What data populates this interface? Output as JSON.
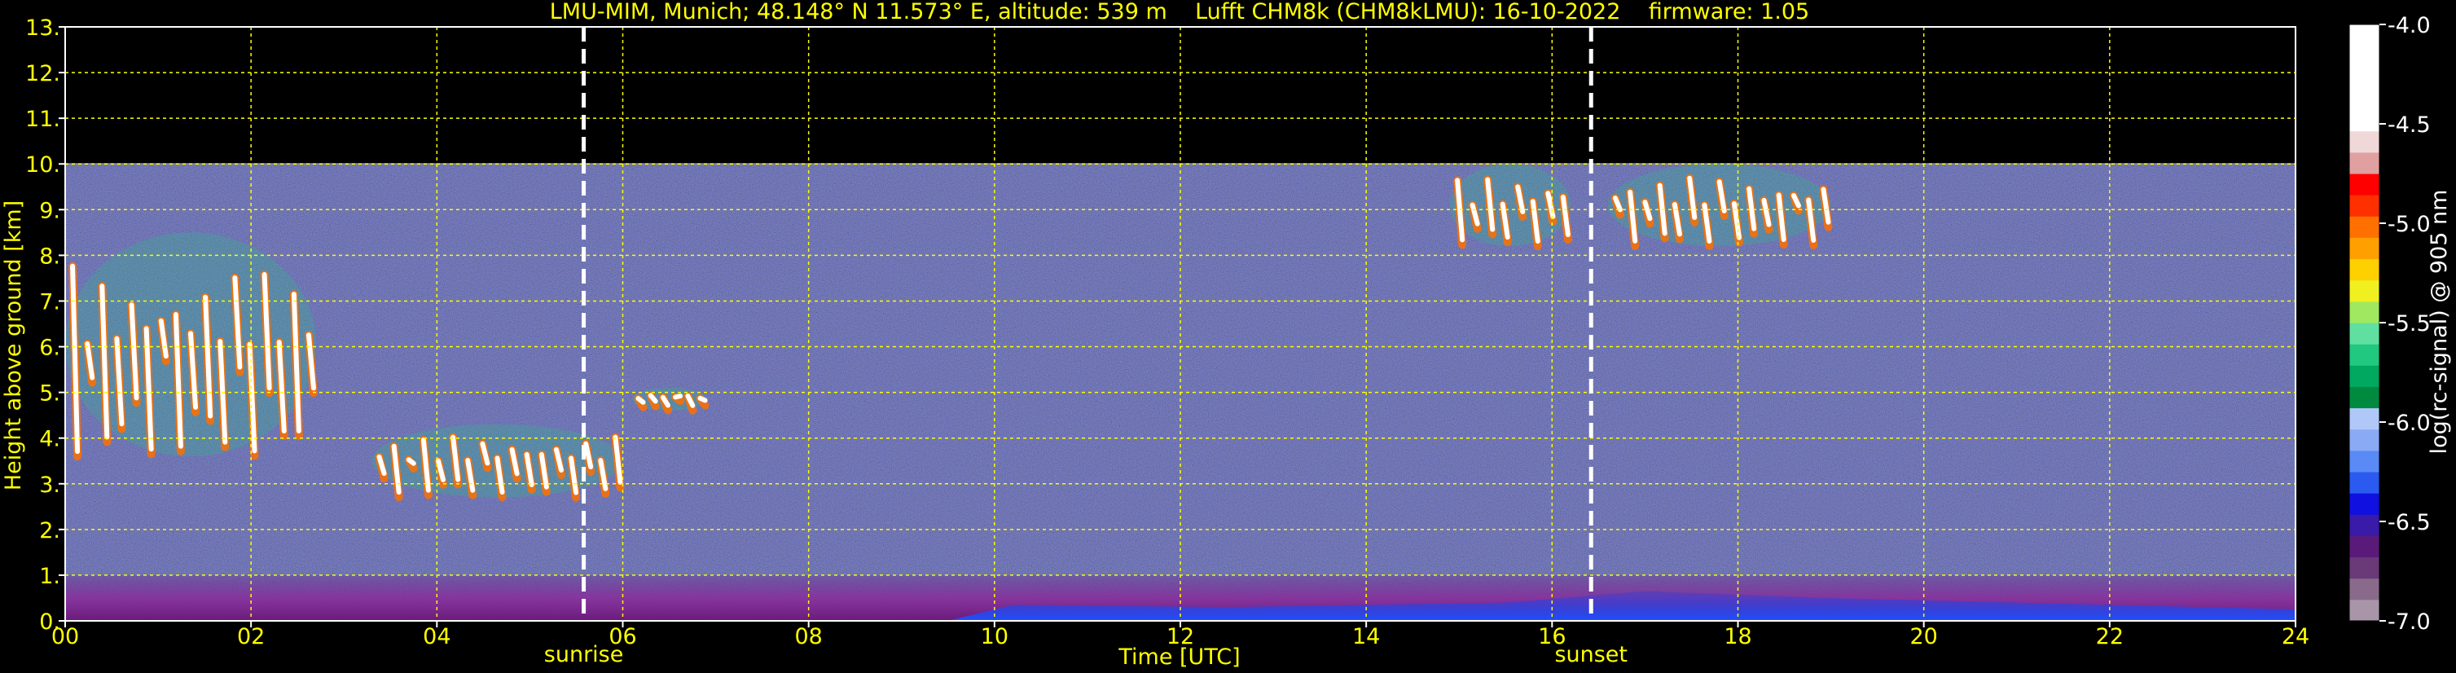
{
  "chart_data": {
    "type": "heatmap",
    "title": "LMU-MIM, Munich; 48.148° N 11.573° E, altitude: 539 m    Lufft CHM8k (CHM8kLMU): 16-10-2022    firmware: 1.05",
    "xlabel": "Time [UTC]",
    "ylabel": "Height above ground [km]",
    "xlim": [
      0,
      24
    ],
    "ylim": [
      0,
      13
    ],
    "x_ticks": [
      "00",
      "02",
      "04",
      "06",
      "08",
      "10",
      "12",
      "14",
      "16",
      "18",
      "20",
      "22",
      "24"
    ],
    "y_ticks": [
      "0.",
      "1.",
      "2.",
      "3.",
      "4.",
      "5.",
      "6.",
      "7.",
      "8.",
      "9.",
      "10.",
      "11.",
      "12.",
      "13."
    ],
    "grid": true,
    "data_top_km": 10,
    "events": [
      {
        "label": "sunrise",
        "time": 5.58
      },
      {
        "label": "sunset",
        "time": 16.42
      }
    ],
    "colorbar": {
      "label": "log(rc-signal) @ 905 nm",
      "range": [
        -7.0,
        -4.0
      ],
      "ticks": [
        "-4.0",
        "-4.5",
        "-5.0",
        "-5.5",
        "-6.0",
        "-6.5",
        "-7.0"
      ],
      "tick_values": [
        -4.0,
        -4.5,
        -5.0,
        -5.5,
        -6.0,
        -6.5,
        -7.0
      ],
      "colors": [
        "#a895a8",
        "#8a6a8a",
        "#6a3a78",
        "#5a1a7a",
        "#3a1aa8",
        "#1010e0",
        "#2a5af0",
        "#5a8af5",
        "#8aaaf5",
        "#b0c8f8",
        "#008a40",
        "#00a860",
        "#20c880",
        "#60e0a0",
        "#a0e860",
        "#f0f020",
        "#ffd000",
        "#ffa000",
        "#ff7000",
        "#ff3000",
        "#ff0000",
        "#e0a0a0",
        "#f0d8d8",
        "#ffffff",
        "#ffffff",
        "#ffffff",
        "#ffffff",
        "#ffffff"
      ]
    },
    "features": {
      "boundary_layer": {
        "from": 0,
        "to": 24,
        "top_km": 1.0
      },
      "clouds": [
        {
          "t0": 0.0,
          "t1": 2.7,
          "h_top": 8.5,
          "h_bottom": 3.6
        },
        {
          "t0": 3.3,
          "t1": 6.0,
          "h_top": 4.3,
          "h_bottom": 2.7
        },
        {
          "t0": 6.1,
          "t1": 6.9,
          "h_top": 5.1,
          "h_bottom": 4.6
        },
        {
          "t0": 14.9,
          "t1": 16.2,
          "h_top": 10.0,
          "h_bottom": 8.2
        },
        {
          "t0": 16.6,
          "t1": 19.0,
          "h_top": 10.0,
          "h_bottom": 8.2
        }
      ]
    },
    "colors": {
      "text": "#ffff00",
      "grid": "#ffff00",
      "background": "#000000",
      "noise_base": "#2a2a6a",
      "event_line": "#ffffff"
    }
  }
}
